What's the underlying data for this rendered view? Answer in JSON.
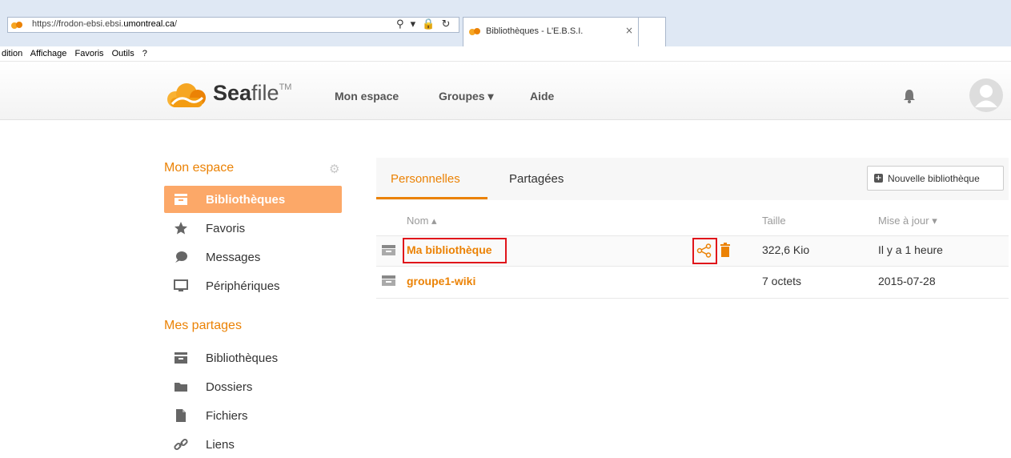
{
  "browser": {
    "url_prefix": "https://frodon-ebsi.ebsi.",
    "url_host": "umontreal.ca",
    "url_suffix": "/",
    "address_controls": "⚲ ▾ 🔒 ↻",
    "tab_title": "Bibliothèques - L'E.B.S.I.",
    "tab_close": "×",
    "menu": [
      "dition",
      "Affichage",
      "Favoris",
      "Outils",
      "?"
    ]
  },
  "header": {
    "logo_sea": "Sea",
    "logo_file": "file",
    "logo_tm": "TM",
    "nav": [
      "Mon espace",
      "Groupes ▾",
      "Aide"
    ]
  },
  "sidebar": {
    "section1_title": "Mon espace",
    "section1_items": [
      {
        "label": "Bibliothèques",
        "icon": "library-icon",
        "active": true
      },
      {
        "label": "Favoris",
        "icon": "star-icon"
      },
      {
        "label": "Messages",
        "icon": "messages-icon"
      },
      {
        "label": "Périphériques",
        "icon": "monitor-icon"
      }
    ],
    "section2_title": "Mes partages",
    "section2_items": [
      {
        "label": "Bibliothèques",
        "icon": "library-icon"
      },
      {
        "label": "Dossiers",
        "icon": "folder-icon"
      },
      {
        "label": "Fichiers",
        "icon": "file-icon"
      },
      {
        "label": "Liens",
        "icon": "link-icon"
      }
    ]
  },
  "main": {
    "tabs": [
      "Personnelles",
      "Partagées"
    ],
    "new_library_label": "Nouvelle bibliothèque",
    "columns": {
      "name": "Nom ▴",
      "size": "Taille",
      "updated": "Mise à jour ▾"
    },
    "rows": [
      {
        "name": "Ma bibliothèque",
        "size": "322,6 Kio",
        "updated": "Il y a 1 heure"
      },
      {
        "name": "groupe1-wiki",
        "size": "7 octets",
        "updated": "2015-07-28"
      }
    ]
  },
  "colors": {
    "accent": "#eb8205",
    "active_item_bg": "#fca868",
    "highlight_box": "#e0151b"
  }
}
